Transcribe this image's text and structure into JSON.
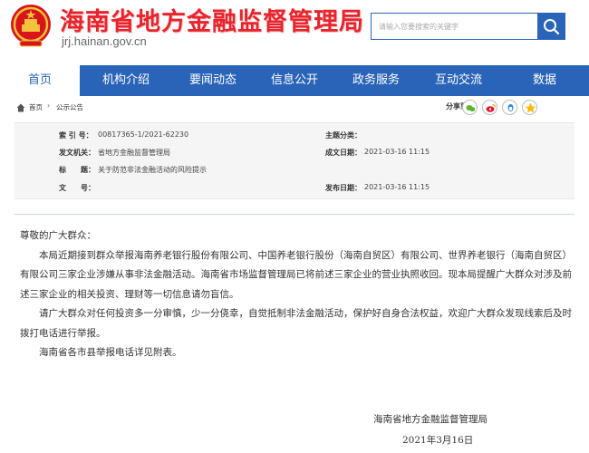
{
  "header": {
    "site_title": "海南省地方金融监督管理局",
    "site_url": "jrj.hainan.gov.cn",
    "search_placeholder": "请输入您要搜索的关键字"
  },
  "nav": [
    {
      "label": "首页",
      "active": true
    },
    {
      "label": "机构介绍"
    },
    {
      "label": "要闻动态"
    },
    {
      "label": "信息公开"
    },
    {
      "label": "政务服务"
    },
    {
      "label": "互动交流"
    },
    {
      "label": "数据"
    }
  ],
  "breadcrumb": {
    "home": "首页",
    "separator": "›",
    "current": "公示公告"
  },
  "share": {
    "label": "分享到：",
    "icons": [
      "wechat-icon",
      "weibo-icon",
      "qq-icon",
      "qzone-icon"
    ]
  },
  "meta": {
    "index_label": "索 引 号：",
    "index_value": "00817365-1/2021-62230",
    "topic_label": "主题分类：",
    "topic_value": "",
    "issuer_label": "发文机关：",
    "issuer_value": "省地方金融监督管理局",
    "date_label": "成文日期：",
    "date_value": "2021-03-16 11:15",
    "title_label": "标　　题：",
    "title_value": "关于防范非法金融活动的风险提示",
    "doc_label": "文　　号：",
    "doc_value": "",
    "publish_label": "发布日期：",
    "publish_value": "2021-03-16 11:15"
  },
  "article": {
    "greeting": "尊敬的广大群众：",
    "paragraphs": [
      "本局近期接到群众举报海南养老银行股份有限公司、中国养老银行股份（海南自贸区）有限公司、世界养老银行（海南自贸区）有限公司三家企业涉嫌从事非法金融活动。海南省市场监督管理局已将前述三家企业的营业执照收回。现本局提醒广大群众对涉及前述三家企业的相关投资、理财等一切信息请勿盲信。",
      "请广大群众对任何投资多一分审慎，少一分侥幸，自觉抵制非法金融活动，保护好自身合法权益，欢迎广大群众发现线索后及时拨打电话进行举报。",
      "海南省各市县举报电话详见附表。"
    ],
    "signature": "海南省地方金融监督管理局",
    "sign_date": "2021年3月16日"
  },
  "colors": {
    "brand_red": "#e8242d",
    "nav_blue": "#2a64b8"
  }
}
